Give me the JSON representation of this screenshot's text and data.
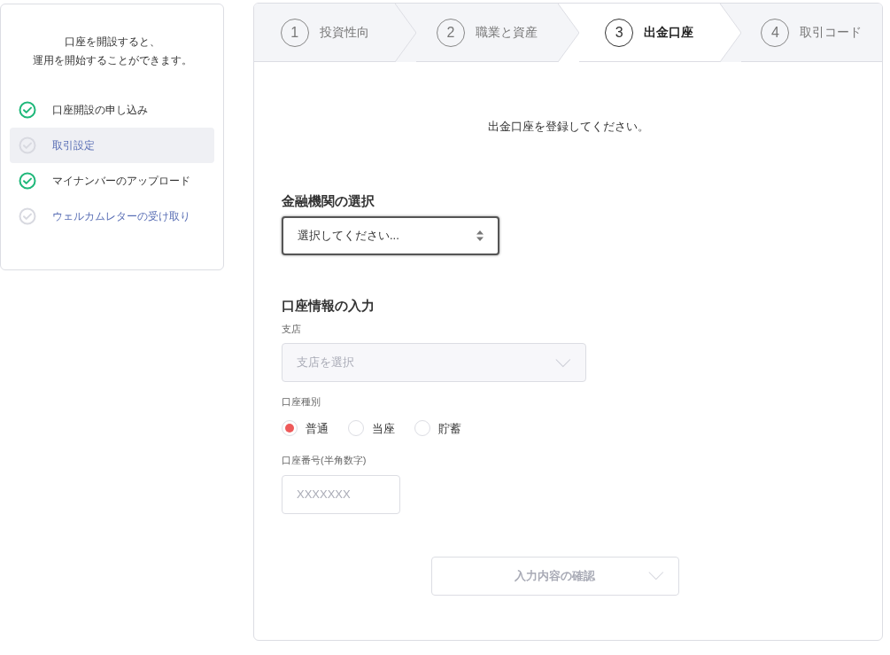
{
  "sidebar": {
    "intro_lines": [
      "口座を開設すると、",
      "運用を開始することができます。"
    ],
    "items": [
      {
        "label": "口座開設の申し込み",
        "done": true,
        "selected": false
      },
      {
        "label": "取引設定",
        "done": false,
        "selected": true
      },
      {
        "label": "マイナンバーのアップロード",
        "done": true,
        "selected": false
      },
      {
        "label": "ウェルカムレターの受け取り",
        "done": false,
        "selected": false
      }
    ]
  },
  "steps": [
    {
      "number": "1",
      "label": "投資性向",
      "selected": false
    },
    {
      "number": "2",
      "label": "職業と資産",
      "selected": false
    },
    {
      "number": "3",
      "label": "出金口座",
      "selected": true
    },
    {
      "number": "4",
      "label": "取引コード",
      "selected": false
    }
  ],
  "instruction": "出金口座を登録してください。",
  "bank_section": {
    "heading": "金融機関の選択",
    "select": {
      "value": "選択してください...",
      "focused": true
    }
  },
  "account_section": {
    "heading": "口座情報の入力",
    "branch": {
      "label": "支店",
      "placeholder": "支店を選択",
      "disabled": true
    },
    "type": {
      "label": "口座種別",
      "options": [
        {
          "label": "普通",
          "selected": true
        },
        {
          "label": "当座",
          "selected": false
        },
        {
          "label": "貯蓄",
          "selected": false
        }
      ]
    },
    "number": {
      "label": "口座番号(半角数字)",
      "placeholder": "XXXXXXX"
    }
  },
  "confirm_button": {
    "label": "入力内容の確認",
    "disabled": true
  }
}
